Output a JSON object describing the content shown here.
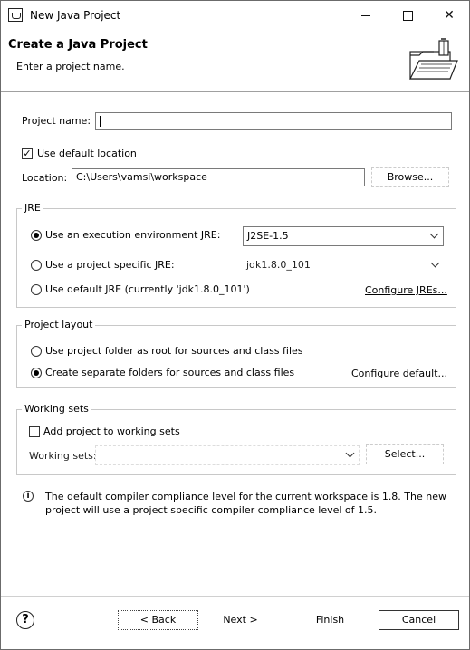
{
  "window": {
    "title": "New Java Project",
    "controls": {
      "minimize": "",
      "maximize": "",
      "close": "✕"
    }
  },
  "header": {
    "title": "Create a Java Project",
    "subtitle": "Enter a project name."
  },
  "project": {
    "name_label": "Project name:",
    "name_value": "",
    "use_default_location_label": "Use default location",
    "use_default_location_checked": true,
    "location_label": "Location:",
    "location_value": "C:\\Users\\vamsi\\workspace",
    "browse_label": "Browse..."
  },
  "jre": {
    "group_title": "JRE",
    "options": [
      {
        "label": "Use an execution environment JRE:",
        "selected": true,
        "value": "J2SE-1.5"
      },
      {
        "label": "Use a project specific JRE:",
        "selected": false,
        "value": "jdk1.8.0_101"
      },
      {
        "label": "Use default JRE (currently 'jdk1.8.0_101')",
        "selected": false
      }
    ],
    "configure_link": "Configure JREs..."
  },
  "layout": {
    "group_title": "Project layout",
    "options": [
      {
        "label": "Use project folder as root for sources and class files",
        "selected": false
      },
      {
        "label": "Create separate folders for sources and class files",
        "selected": true
      }
    ],
    "configure_link": "Configure default..."
  },
  "working_sets": {
    "group_title": "Working sets",
    "add_label": "Add project to working sets",
    "add_checked": false,
    "sets_label": "Working sets:",
    "sets_value": "",
    "select_label": "Select..."
  },
  "info": {
    "line1": "The default compiler compliance level for the current workspace is 1.8. The new",
    "line2": "project will use a project specific compiler compliance level of 1.5."
  },
  "footer": {
    "help": "?",
    "back_label": "< Back",
    "next_label": "Next >",
    "finish_label": "Finish",
    "cancel_label": "Cancel"
  }
}
